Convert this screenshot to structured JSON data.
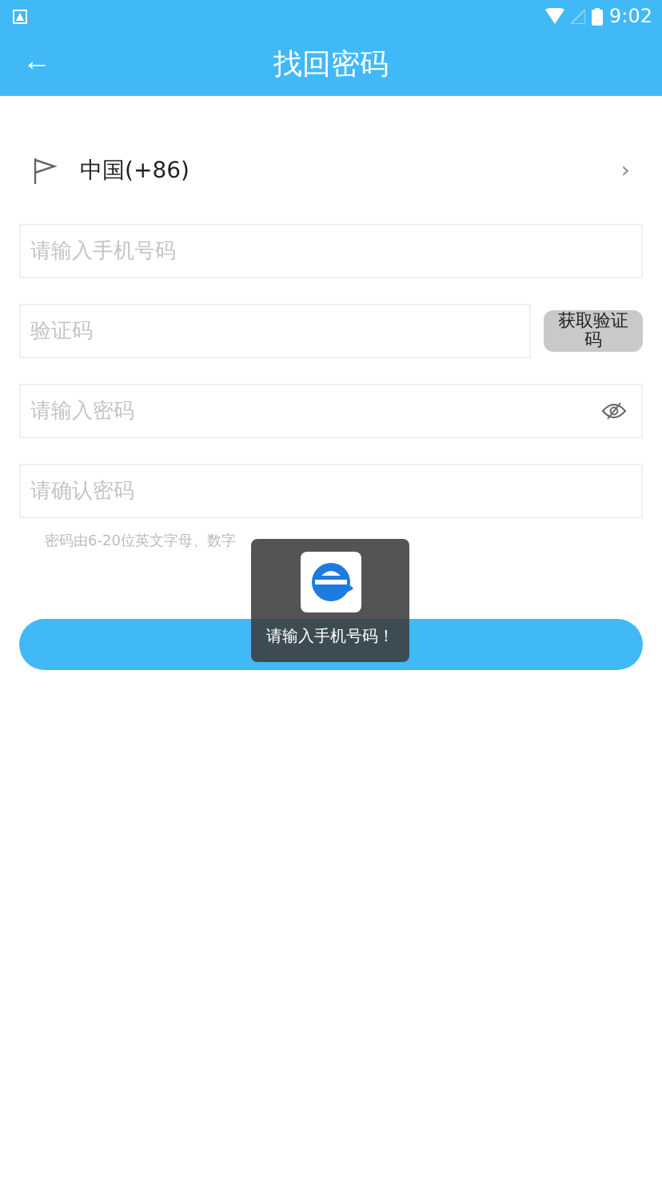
{
  "status_bar": {
    "time": "9:02"
  },
  "header": {
    "back": "←",
    "title": "找回密码"
  },
  "country": {
    "label": "中国(+86)",
    "chevron": "›"
  },
  "fields": [
    {
      "kind": "text",
      "placeholder": "请输入手机号码"
    },
    {
      "kind": "code",
      "placeholder": "验证码",
      "button": "获取验证码"
    },
    {
      "kind": "password",
      "placeholder": "请输入密码"
    },
    {
      "kind": "text",
      "placeholder": "请确认密码"
    }
  ],
  "hint": "密码由6-20位英文字母、数字",
  "submit": {
    "kind": "button"
  },
  "toast": {
    "message": "请输入手机号码！"
  }
}
